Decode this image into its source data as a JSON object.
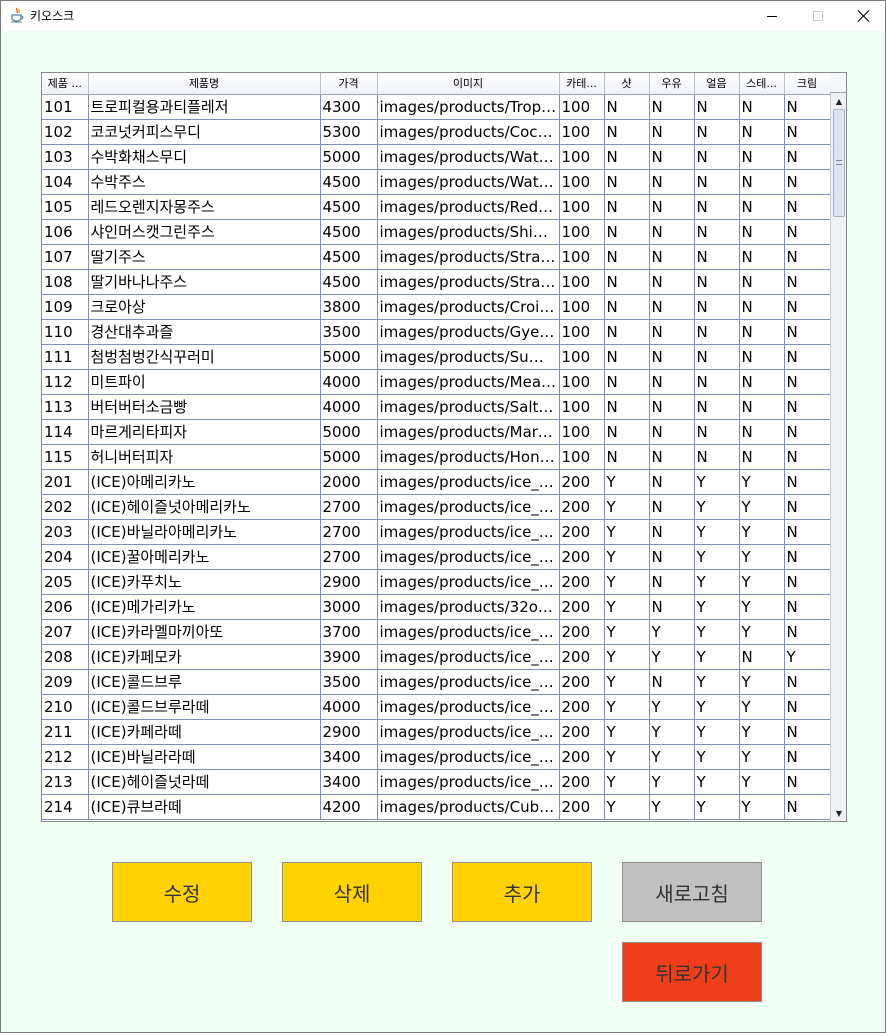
{
  "window": {
    "title": "키오스크"
  },
  "table": {
    "columns": [
      "제품 ...",
      "제품명",
      "가격",
      "이미지",
      "카테...",
      "샷",
      "우유",
      "얼음",
      "스테...",
      "크림"
    ],
    "rows": [
      [
        "101",
        "트로피컬용과티플레저",
        "4300",
        "images/products/Tropic...",
        "100",
        "N",
        "N",
        "N",
        "N",
        "N"
      ],
      [
        "102",
        "코코넛커피스무디",
        "5300",
        "images/products/Cocon...",
        "100",
        "N",
        "N",
        "N",
        "N",
        "N"
      ],
      [
        "103",
        "수박화채스무디",
        "5000",
        "images/products/Water...",
        "100",
        "N",
        "N",
        "N",
        "N",
        "N"
      ],
      [
        "104",
        "수박주스",
        "4500",
        "images/products/Water...",
        "100",
        "N",
        "N",
        "N",
        "N",
        "N"
      ],
      [
        "105",
        "레드오렌지자몽주스",
        "4500",
        "images/products/Red O...",
        "100",
        "N",
        "N",
        "N",
        "N",
        "N"
      ],
      [
        "106",
        "샤인머스캣그린주스",
        "4500",
        "images/products/Shine ...",
        "100",
        "N",
        "N",
        "N",
        "N",
        "N"
      ],
      [
        "107",
        "딸기주스",
        "4500",
        "images/products/Straw...",
        "100",
        "N",
        "N",
        "N",
        "N",
        "N"
      ],
      [
        "108",
        "딸기바나나주스",
        "4500",
        "images/products/Straw...",
        "100",
        "N",
        "N",
        "N",
        "N",
        "N"
      ],
      [
        "109",
        "크로아상",
        "3800",
        "images/products/Croiss...",
        "100",
        "N",
        "N",
        "N",
        "N",
        "N"
      ],
      [
        "110",
        "경산대추과즐",
        "3500",
        "images/products/Gyeon...",
        "100",
        "N",
        "N",
        "N",
        "N",
        "N"
      ],
      [
        "111",
        "첨벙첨벙간식꾸러미",
        "5000",
        "images/products/Summ...",
        "100",
        "N",
        "N",
        "N",
        "N",
        "N"
      ],
      [
        "112",
        "미트파이",
        "4000",
        "images/products/Meat ...",
        "100",
        "N",
        "N",
        "N",
        "N",
        "N"
      ],
      [
        "113",
        "버터버터소금빵",
        "4000",
        "images/products/Salty ...",
        "100",
        "N",
        "N",
        "N",
        "N",
        "N"
      ],
      [
        "114",
        "마르게리타피자",
        "5000",
        "images/products/Margh...",
        "100",
        "N",
        "N",
        "N",
        "N",
        "N"
      ],
      [
        "115",
        "허니버터피자",
        "5000",
        "images/products/Honey...",
        "100",
        "N",
        "N",
        "N",
        "N",
        "N"
      ],
      [
        "201",
        "(ICE)아메리카노",
        "2000",
        "images/products/ice_A...",
        "200",
        "Y",
        "N",
        "Y",
        "Y",
        "N"
      ],
      [
        "202",
        "(ICE)헤이즐넛아메리카노",
        "2700",
        "images/products/ice_H...",
        "200",
        "Y",
        "N",
        "Y",
        "Y",
        "N"
      ],
      [
        "203",
        "(ICE)바닐라아메리카노",
        "2700",
        "images/products/ice_V...",
        "200",
        "Y",
        "N",
        "Y",
        "Y",
        "N"
      ],
      [
        "204",
        "(ICE)꿀아메리카노",
        "2700",
        "images/products/ice_H...",
        "200",
        "Y",
        "N",
        "Y",
        "Y",
        "N"
      ],
      [
        "205",
        "(ICE)카푸치노",
        "2900",
        "images/products/ice_C...",
        "200",
        "Y",
        "N",
        "Y",
        "Y",
        "N"
      ],
      [
        "206",
        "(ICE)메가리카노",
        "3000",
        "images/products/32oz ...",
        "200",
        "Y",
        "N",
        "Y",
        "Y",
        "N"
      ],
      [
        "207",
        "(ICE)카라멜마끼아또",
        "3700",
        "images/products/ice_C...",
        "200",
        "Y",
        "Y",
        "Y",
        "Y",
        "N"
      ],
      [
        "208",
        "(ICE)카페모카",
        "3900",
        "images/products/ice_C...",
        "200",
        "Y",
        "Y",
        "Y",
        "N",
        "Y"
      ],
      [
        "209",
        "(ICE)콜드브루",
        "3500",
        "images/products/ice_C...",
        "200",
        "Y",
        "N",
        "Y",
        "Y",
        "N"
      ],
      [
        "210",
        "(ICE)콜드브루라떼",
        "4000",
        "images/products/ice_C...",
        "200",
        "Y",
        "Y",
        "Y",
        "Y",
        "N"
      ],
      [
        "211",
        "(ICE)카페라떼",
        "2900",
        "images/products/ice_C...",
        "200",
        "Y",
        "Y",
        "Y",
        "Y",
        "N"
      ],
      [
        "212",
        "(ICE)바닐라라떼",
        "3400",
        "images/products/ice_V...",
        "200",
        "Y",
        "Y",
        "Y",
        "Y",
        "N"
      ],
      [
        "213",
        "(ICE)헤이즐넛라떼",
        "3400",
        "images/products/ice_H...",
        "200",
        "Y",
        "Y",
        "Y",
        "Y",
        "N"
      ],
      [
        "214",
        "(ICE)큐브라떼",
        "4200",
        "images/products/Cube ...",
        "200",
        "Y",
        "Y",
        "Y",
        "Y",
        "N"
      ]
    ]
  },
  "buttons": {
    "edit": "수정",
    "delete": "삭제",
    "add": "추가",
    "refresh": "새로고침",
    "back": "뒤로가기"
  },
  "colors": {
    "window_bg": "#f0fff5",
    "action_button": "#ffd200",
    "refresh_button": "#c0c0c0",
    "back_button": "#ef3e1a",
    "grid_line": "#7d91b3"
  },
  "icons": {
    "app": "java-cup-icon",
    "minimize": "minimize-icon",
    "maximize": "maximize-icon",
    "close": "close-icon"
  }
}
